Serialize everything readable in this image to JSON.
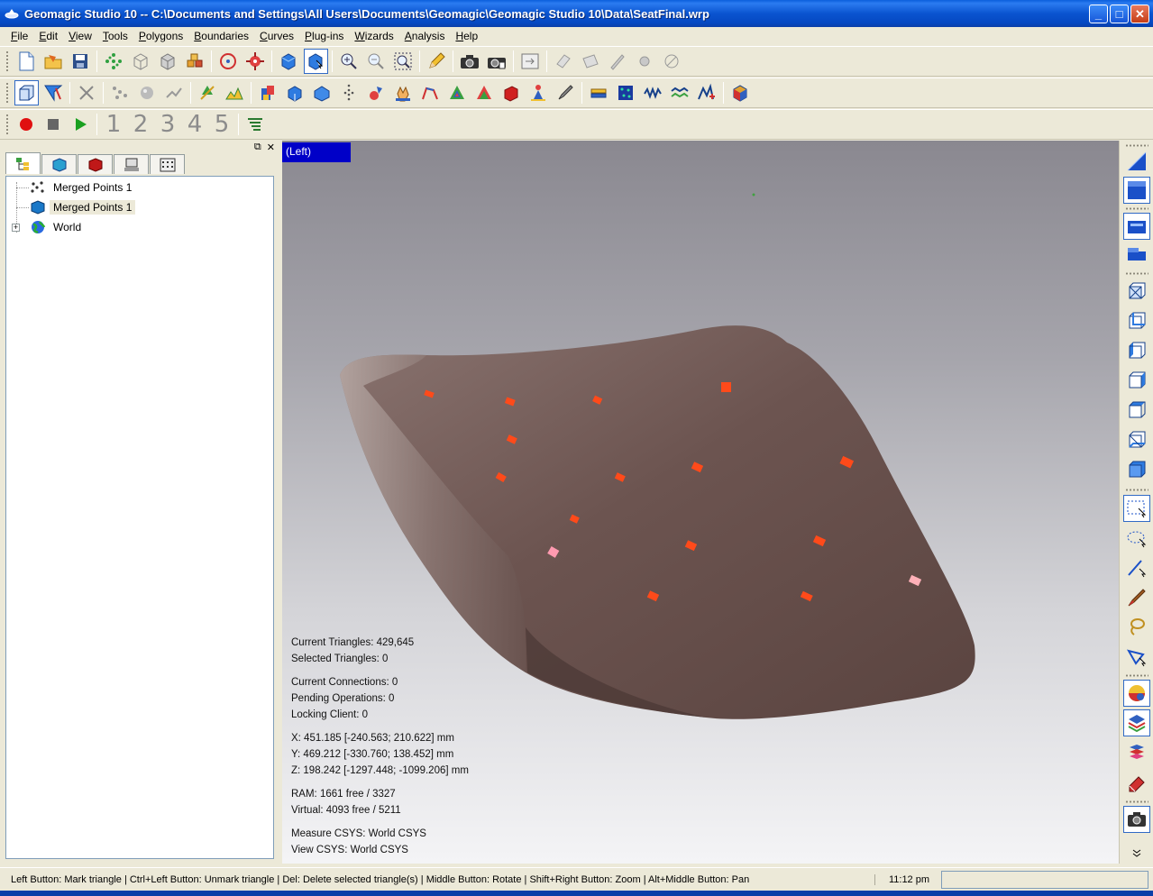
{
  "window": {
    "title": "Geomagic Studio 10 -- C:\\Documents and Settings\\All Users\\Documents\\Geomagic\\Geomagic Studio 10\\Data\\SeatFinal.wrp"
  },
  "menu": [
    {
      "label": "File",
      "u": "F",
      "rest": "ile"
    },
    {
      "label": "Edit",
      "u": "E",
      "rest": "dit"
    },
    {
      "label": "View",
      "u": "V",
      "rest": "iew"
    },
    {
      "label": "Tools",
      "u": "T",
      "rest": "ools"
    },
    {
      "label": "Polygons",
      "u": "P",
      "rest": "olygons"
    },
    {
      "label": "Boundaries",
      "u": "B",
      "rest": "oundaries"
    },
    {
      "label": "Curves",
      "u": "C",
      "rest": "urves"
    },
    {
      "label": "Plug-ins",
      "u": "P",
      "rest": "lug-ins"
    },
    {
      "label": "Wizards",
      "u": "W",
      "rest": "izards"
    },
    {
      "label": "Analysis",
      "u": "A",
      "rest": "nalysis"
    },
    {
      "label": "Help",
      "u": "H",
      "rest": "elp"
    }
  ],
  "macro_toolbar": {
    "numbers": [
      "1",
      "2",
      "3",
      "4",
      "5"
    ]
  },
  "tree": {
    "items": [
      {
        "label": "Merged Points 1",
        "icon": "point-cloud-icon"
      },
      {
        "label": "Merged Points 1",
        "icon": "polygon-object-icon"
      },
      {
        "label": "World",
        "icon": "globe-icon"
      }
    ]
  },
  "viewport": {
    "view_name": "(Left)",
    "stats": {
      "current_triangles": "Current Triangles: 429,645",
      "selected_triangles": "Selected Triangles: 0",
      "current_connections": "Current Connections: 0",
      "pending_operations": "Pending Operations: 0",
      "locking_client": "Locking Client: 0",
      "x": "X: 451.185 [-240.563; 210.622] mm",
      "y": "Y: 469.212 [-330.760; 138.452] mm",
      "z": "Z: 198.242 [-1297.448; -1099.206] mm",
      "ram": "RAM: 1661 free / 3327",
      "virtual": "Virtual: 4093 free / 5211",
      "measure_csys": "Measure CSYS: World CSYS",
      "view_csys": "View CSYS: World CSYS"
    }
  },
  "status": {
    "message": "Left Button: Mark triangle | Ctrl+Left Button: Unmark triangle | Del: Delete selected triangle(s) | Middle Button: Rotate | Shift+Right Button: Zoom | Alt+Middle Button: Pan",
    "time": "11:12 pm"
  },
  "colors": {
    "titlebar": "#0a54d0",
    "chrome": "#ece9d8",
    "view_label": "#0000c8",
    "seat": "#6e5450",
    "marker": "#ff4a1a"
  }
}
